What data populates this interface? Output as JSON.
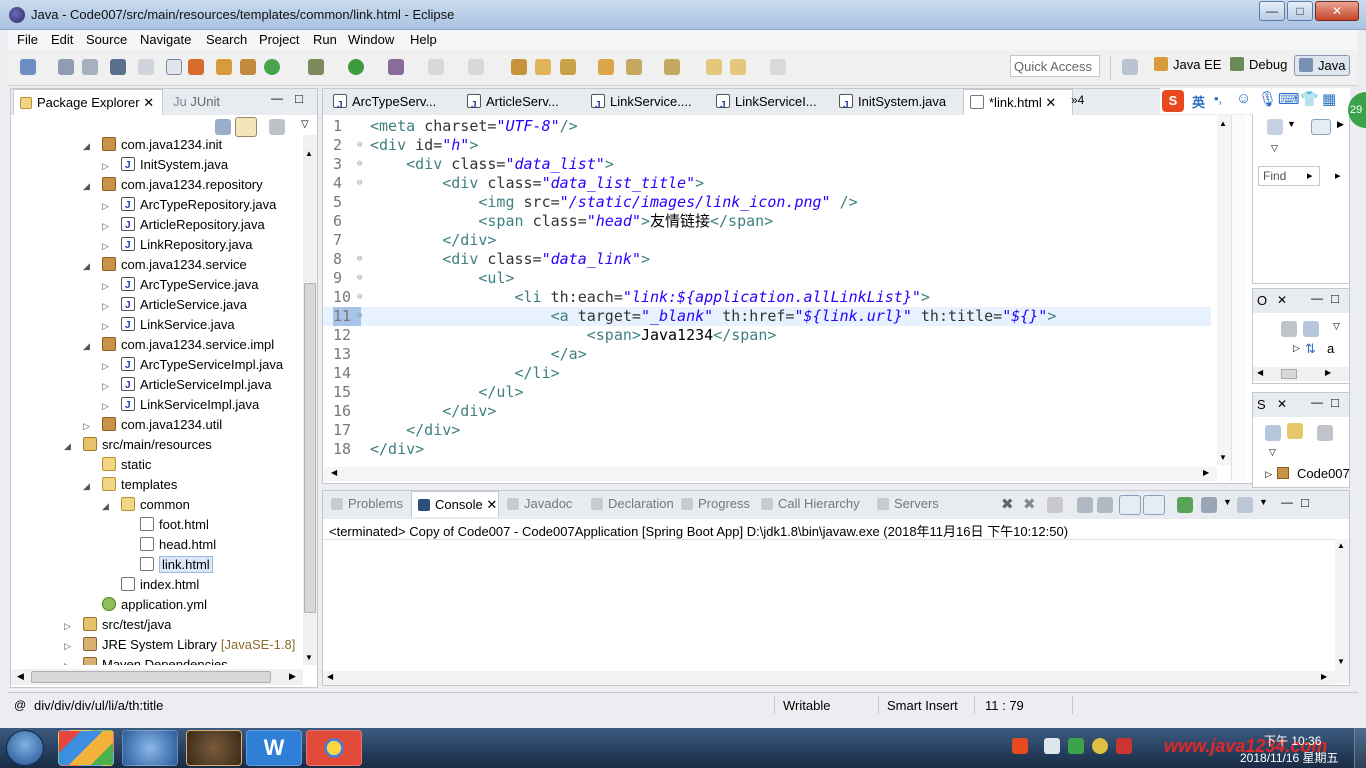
{
  "window": {
    "title": "Java - Code007/src/main/resources/templates/common/link.html - Eclipse",
    "minimize": "—",
    "maximize": "□",
    "close": "✕"
  },
  "menu": [
    "File",
    "Edit",
    "Source",
    "Navigate",
    "Search",
    "Project",
    "Run",
    "Window",
    "Help"
  ],
  "toolbar": {
    "quick_access_placeholder": "Quick Access",
    "perspectives": [
      "Java EE",
      "Debug",
      "Java"
    ]
  },
  "package_explorer": {
    "tabs": [
      "Package Explorer",
      "JUnit"
    ],
    "rows": [
      {
        "label": "com.java1234.init",
        "icon": "package-icon",
        "indent": 0,
        "arrow": "◢"
      },
      {
        "label": "InitSystem.java",
        "icon": "java-file-icon",
        "indent": 1,
        "arrow": "▷"
      },
      {
        "label": "com.java1234.repository",
        "icon": "package-icon",
        "indent": 0,
        "arrow": "◢"
      },
      {
        "label": "ArcTypeRepository.java",
        "icon": "java-file-icon",
        "indent": 1,
        "arrow": "▷"
      },
      {
        "label": "ArticleRepository.java",
        "icon": "java-file-icon",
        "indent": 1,
        "arrow": "▷"
      },
      {
        "label": "LinkRepository.java",
        "icon": "java-file-icon",
        "indent": 1,
        "arrow": "▷"
      },
      {
        "label": "com.java1234.service",
        "icon": "package-icon",
        "indent": 0,
        "arrow": "◢"
      },
      {
        "label": "ArcTypeService.java",
        "icon": "java-file-icon",
        "indent": 1,
        "arrow": "▷"
      },
      {
        "label": "ArticleService.java",
        "icon": "java-file-icon",
        "indent": 1,
        "arrow": "▷"
      },
      {
        "label": "LinkService.java",
        "icon": "java-file-icon",
        "indent": 1,
        "arrow": "▷"
      },
      {
        "label": "com.java1234.service.impl",
        "icon": "package-icon",
        "indent": 0,
        "arrow": "◢"
      },
      {
        "label": "ArcTypeServiceImpl.java",
        "icon": "java-file-icon",
        "indent": 1,
        "arrow": "▷"
      },
      {
        "label": "ArticleServiceImpl.java",
        "icon": "java-file-icon",
        "indent": 1,
        "arrow": "▷"
      },
      {
        "label": "LinkServiceImpl.java",
        "icon": "java-file-icon",
        "indent": 1,
        "arrow": "▷"
      },
      {
        "label": "com.java1234.util",
        "icon": "package-icon",
        "indent": 0,
        "arrow": "▷"
      },
      {
        "label": "src/main/resources",
        "icon": "source-folder-icon",
        "indent": -1,
        "arrow": "◢"
      },
      {
        "label": "static",
        "icon": "folder-icon",
        "indent": 0,
        "arrow": ""
      },
      {
        "label": "templates",
        "icon": "folder-icon",
        "indent": 0,
        "arrow": "◢"
      },
      {
        "label": "common",
        "icon": "folder-icon",
        "indent": 1,
        "arrow": "◢"
      },
      {
        "label": "foot.html",
        "icon": "html-file-icon",
        "indent": 2,
        "arrow": ""
      },
      {
        "label": "head.html",
        "icon": "html-file-icon",
        "indent": 2,
        "arrow": ""
      },
      {
        "label": "link.html",
        "icon": "html-file-icon",
        "indent": 2,
        "arrow": "",
        "selected": true
      },
      {
        "label": "index.html",
        "icon": "html-file-icon",
        "indent": 1,
        "arrow": ""
      },
      {
        "label": "application.yml",
        "icon": "yml-file-icon",
        "indent": 0,
        "arrow": ""
      },
      {
        "label": "src/test/java",
        "icon": "source-folder-icon",
        "indent": -1,
        "arrow": "▷"
      },
      {
        "label": "JRE System Library",
        "suffix": "[JavaSE-1.8]",
        "icon": "library-icon",
        "indent": -1,
        "arrow": "▷"
      },
      {
        "label": "Maven Dependencies",
        "icon": "library-icon",
        "indent": -1,
        "arrow": "▷"
      }
    ]
  },
  "editor_tabs": [
    {
      "label": "ArcTypeServ..."
    },
    {
      "label": "ArticleServ..."
    },
    {
      "label": "LinkService...."
    },
    {
      "label": "LinkServiceI..."
    },
    {
      "label": "InitSystem.java"
    },
    {
      "label": "*link.html",
      "active": true
    }
  ],
  "editor_overflow": "»4",
  "code_lines": [
    {
      "n": "1",
      "fold": "",
      "parts": [
        [
          "tag",
          "<meta "
        ],
        [
          "attr",
          "charset="
        ],
        [
          "val",
          "\"UTF-8\""
        ],
        [
          "tag",
          "/>"
        ]
      ]
    },
    {
      "n": "2",
      "fold": "⊖",
      "parts": [
        [
          "tag",
          "<div "
        ],
        [
          "attr",
          "id="
        ],
        [
          "val",
          "\"h\""
        ],
        [
          "tag",
          ">"
        ]
      ]
    },
    {
      "n": "3",
      "fold": "⊖",
      "parts": [
        [
          "txt",
          "    "
        ],
        [
          "tag",
          "<div "
        ],
        [
          "attr",
          "class="
        ],
        [
          "val",
          "\"data_list\""
        ],
        [
          "tag",
          ">"
        ]
      ]
    },
    {
      "n": "4",
      "fold": "⊖",
      "parts": [
        [
          "txt",
          "        "
        ],
        [
          "tag",
          "<div "
        ],
        [
          "attr",
          "class="
        ],
        [
          "val",
          "\"data_list_title\""
        ],
        [
          "tag",
          ">"
        ]
      ]
    },
    {
      "n": "5",
      "fold": "",
      "parts": [
        [
          "txt",
          "            "
        ],
        [
          "tag",
          "<img "
        ],
        [
          "attr",
          "src="
        ],
        [
          "val",
          "\"/static/images/link_icon.png\""
        ],
        [
          "tag",
          " />"
        ]
      ]
    },
    {
      "n": "6",
      "fold": "",
      "parts": [
        [
          "txt",
          "            "
        ],
        [
          "tag",
          "<span "
        ],
        [
          "attr",
          "class="
        ],
        [
          "val",
          "\"head\""
        ],
        [
          "tag",
          ">"
        ],
        [
          "txt",
          "友情链接"
        ],
        [
          "tag",
          "</span>"
        ]
      ]
    },
    {
      "n": "7",
      "fold": "",
      "parts": [
        [
          "txt",
          "        "
        ],
        [
          "tag",
          "</div>"
        ]
      ]
    },
    {
      "n": "8",
      "fold": "⊖",
      "parts": [
        [
          "txt",
          "        "
        ],
        [
          "tag",
          "<div "
        ],
        [
          "attr",
          "class="
        ],
        [
          "val",
          "\"data_link\""
        ],
        [
          "tag",
          ">"
        ]
      ]
    },
    {
      "n": "9",
      "fold": "⊖",
      "parts": [
        [
          "txt",
          "            "
        ],
        [
          "tag",
          "<ul>"
        ]
      ]
    },
    {
      "n": "10",
      "fold": "⊖",
      "parts": [
        [
          "txt",
          "                "
        ],
        [
          "tag",
          "<li "
        ],
        [
          "attr",
          "th:each="
        ],
        [
          "val",
          "\"link:${application.allLinkList}\""
        ],
        [
          "tag",
          ">"
        ]
      ]
    },
    {
      "n": "11",
      "fold": "⊖",
      "current": true,
      "parts": [
        [
          "txt",
          "                    "
        ],
        [
          "tag",
          "<a "
        ],
        [
          "attr",
          "target="
        ],
        [
          "val",
          "\"_blank\""
        ],
        [
          "attr",
          " th:href="
        ],
        [
          "val",
          "\"${link.url}\""
        ],
        [
          "attr",
          " th:title="
        ],
        [
          "val",
          "\"${}\""
        ],
        [
          "tag",
          ">"
        ]
      ]
    },
    {
      "n": "12",
      "fold": "",
      "parts": [
        [
          "txt",
          "                        "
        ],
        [
          "tag",
          "<span>"
        ],
        [
          "txt",
          "Java1234"
        ],
        [
          "tag",
          "</span>"
        ]
      ]
    },
    {
      "n": "13",
      "fold": "",
      "parts": [
        [
          "txt",
          "                    "
        ],
        [
          "tag",
          "</a>"
        ]
      ]
    },
    {
      "n": "14",
      "fold": "",
      "parts": [
        [
          "txt",
          "                "
        ],
        [
          "tag",
          "</li>"
        ]
      ]
    },
    {
      "n": "15",
      "fold": "",
      "parts": [
        [
          "txt",
          "            "
        ],
        [
          "tag",
          "</ul>"
        ]
      ]
    },
    {
      "n": "16",
      "fold": "",
      "parts": [
        [
          "txt",
          "        "
        ],
        [
          "tag",
          "</div>"
        ]
      ]
    },
    {
      "n": "17",
      "fold": "",
      "parts": [
        [
          "txt",
          "    "
        ],
        [
          "tag",
          "</div>"
        ]
      ]
    },
    {
      "n": "18",
      "fold": "",
      "parts": [
        [
          "tag",
          "</div>"
        ]
      ]
    }
  ],
  "console_tabs": [
    "Problems",
    "Console",
    "Javadoc",
    "Declaration",
    "Progress",
    "Call Hierarchy",
    "Servers"
  ],
  "console_text": "<terminated> Copy of Code007 - Code007Application [Spring Boot App] D:\\jdk1.8\\bin\\javaw.exe (2018年11月16日 下午10:12:50)",
  "right_panels": {
    "find_placeholder": "Find",
    "outline_tab": "O",
    "outline_item": "a",
    "servers_tab": "S",
    "servers_item": "Code007",
    "badge": "29"
  },
  "ime": {
    "lang": "英",
    "logo": "S"
  },
  "status": {
    "path": "div/div/div/ul/li/a/th:title",
    "writable": "Writable",
    "insert_mode": "Smart Insert",
    "position": "11 : 79"
  },
  "taskbar": {
    "time": "下午 10:36",
    "date": "2018/11/16 星期五",
    "watermark": "www.java1234.com"
  },
  "colors": {
    "tag": "#3f7f7f",
    "value": "#2a00ff",
    "line_number": "#787878",
    "current_line": "#e8f2fe"
  }
}
